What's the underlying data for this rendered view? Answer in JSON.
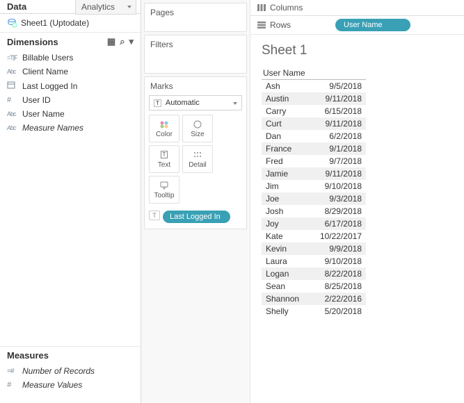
{
  "tabs": {
    "data": "Data",
    "analytics": "Analytics"
  },
  "datasource": {
    "name": "Sheet1 (Uptodate)"
  },
  "dimensions": {
    "header": "Dimensions",
    "fields": [
      {
        "icon": "tf",
        "label": "Billable Users"
      },
      {
        "icon": "abc",
        "label": "Client Name"
      },
      {
        "icon": "date",
        "label": "Last Logged In"
      },
      {
        "icon": "hash",
        "label": "User ID"
      },
      {
        "icon": "abc",
        "label": "User Name"
      },
      {
        "icon": "abc",
        "label": "Measure Names",
        "italic": true
      }
    ]
  },
  "measures": {
    "header": "Measures",
    "fields": [
      {
        "icon": "nhash",
        "label": "Number of Records",
        "italic": true
      },
      {
        "icon": "hash",
        "label": "Measure Values",
        "italic": true
      }
    ]
  },
  "shelves": {
    "pages": "Pages",
    "filters": "Filters",
    "marks": "Marks",
    "marks_dropdown": "Automatic",
    "mark_cells": {
      "color": "Color",
      "size": "Size",
      "text": "Text",
      "detail": "Detail",
      "tooltip": "Tooltip"
    },
    "mark_pill": "Last Logged In"
  },
  "colrow": {
    "columns": "Columns",
    "rows": "Rows",
    "rows_pill": "User Name"
  },
  "viz": {
    "title": "Sheet 1",
    "header": "User Name",
    "rows": [
      {
        "name": "Ash",
        "val": "9/5/2018"
      },
      {
        "name": "Austin",
        "val": "9/11/2018"
      },
      {
        "name": "Carry",
        "val": "6/15/2018"
      },
      {
        "name": "Curt",
        "val": "9/11/2018"
      },
      {
        "name": "Dan",
        "val": "6/2/2018"
      },
      {
        "name": "France",
        "val": "9/1/2018"
      },
      {
        "name": "Fred",
        "val": "9/7/2018"
      },
      {
        "name": "Jamie",
        "val": "9/11/2018"
      },
      {
        "name": "Jim",
        "val": "9/10/2018"
      },
      {
        "name": "Joe",
        "val": "9/3/2018"
      },
      {
        "name": "Josh",
        "val": "8/29/2018"
      },
      {
        "name": "Joy",
        "val": "6/17/2018"
      },
      {
        "name": "Kate",
        "val": "10/22/2017"
      },
      {
        "name": "Kevin",
        "val": "9/9/2018"
      },
      {
        "name": "Laura",
        "val": "9/10/2018"
      },
      {
        "name": "Logan",
        "val": "8/22/2018"
      },
      {
        "name": "Sean",
        "val": "8/25/2018"
      },
      {
        "name": "Shannon",
        "val": "2/22/2016"
      },
      {
        "name": "Shelly",
        "val": "5/20/2018"
      }
    ]
  }
}
